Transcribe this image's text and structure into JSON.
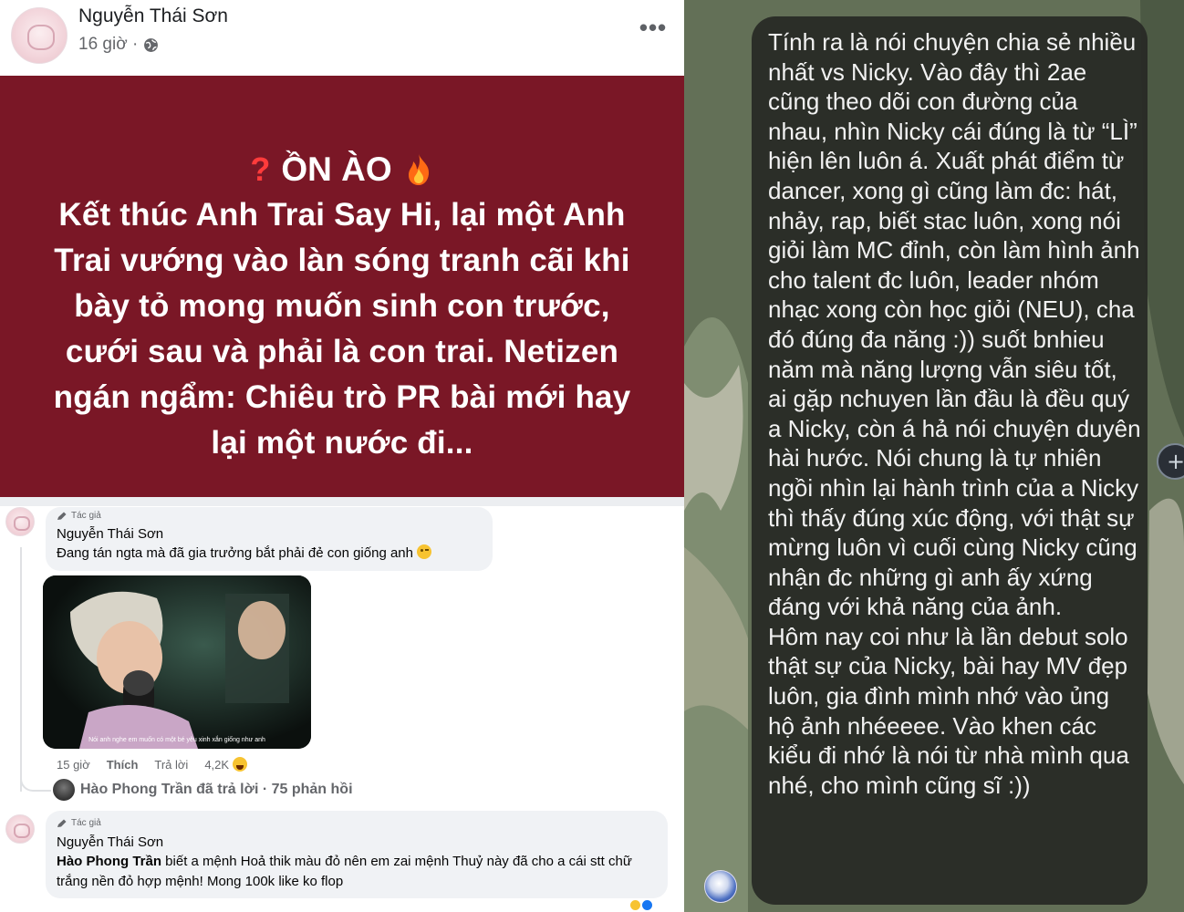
{
  "post": {
    "author": "Nguyễn Thái Sơn",
    "time": "16 giờ ·",
    "more_icon": "more-icon"
  },
  "banner": {
    "tag": "ỒN ÀO",
    "headline": "Kết thúc Anh Trai Say Hi, lại một Anh Trai vướng vào làn sóng tranh cãi khi bày tỏ mong muốn sinh con trước, cưới sau và phải là con trai. Netizen ngán ngẩm: Chiêu trò PR bài mới hay lại một nước đi...",
    "colors": {
      "background": "#7a1726",
      "text": "#ffffff",
      "question": "#ff3b3b",
      "fire": "#ff7a1a"
    }
  },
  "comments": [
    {
      "author_tag": "Tác giả",
      "author": "Nguyễn Thái Sơn",
      "text": "Đang tán ngta mà đã gia trưởng bắt phải đẻ con giống anh",
      "photo_caption": "Nói anh nghe em muốn có một bé yêu xinh xắn giống như anh",
      "time": "15 giờ",
      "like_label": "Thích",
      "reply_label": "Trả lời",
      "reaction_count": "4,2K",
      "replies_summary": "Hào Phong Trần đã trả lời · 75 phản hồi"
    },
    {
      "author_tag": "Tác giả",
      "author": "Nguyễn Thái Sơn",
      "mention": "Hào Phong Trần",
      "text": " biết a mệnh Hoả thik màu đỏ nên em zai mệnh Thuỷ này đã cho a cái stt chữ trắng nền đỏ hợp mệnh! Mong 100k like ko flop"
    }
  ],
  "message": {
    "text": "Tính ra là nói chuyện chia sẻ nhiều nhất vs Nicky. Vào đây thì 2ae cũng theo dõi con đường của nhau, nhìn Nicky cái đúng là từ “LÌ” hiện lên luôn á. Xuất phát điểm từ dancer, xong gì cũng làm đc:  hát, nhảy, rap, biết stac luôn, xong nói giỏi làm MC đỉnh, còn làm hình ảnh cho talent đc luôn, leader nhóm nhạc xong còn học giỏi (NEU), cha đó đúng đa năng :)) suốt bnhieu năm mà năng lượng vẫn siêu tốt, ai gặp nchuyen lần đầu là đều quý a Nicky, còn á hả nói chuyện duyên hài hước. Nói chung là tự nhiên ngồi nhìn lại hành trình của a Nicky thì thấy đúng xúc động, với thật sự mừng luôn vì cuối cùng Nicky cũng nhận đc những gì anh ấy xứng đáng với khả năng của ảnh.\nHôm nay coi như là lần debut solo thật sự của Nicky, bài hay MV đẹp luôn, gia đình mình nhớ vào ủng hộ ảnh nhéeeee. Vào khen các kiểu đi nhớ là nói từ nhà mình qua nhé, cho mình cũng sĩ :))",
    "bubble_color": "#282a26",
    "text_color": "#f2f2f2"
  }
}
